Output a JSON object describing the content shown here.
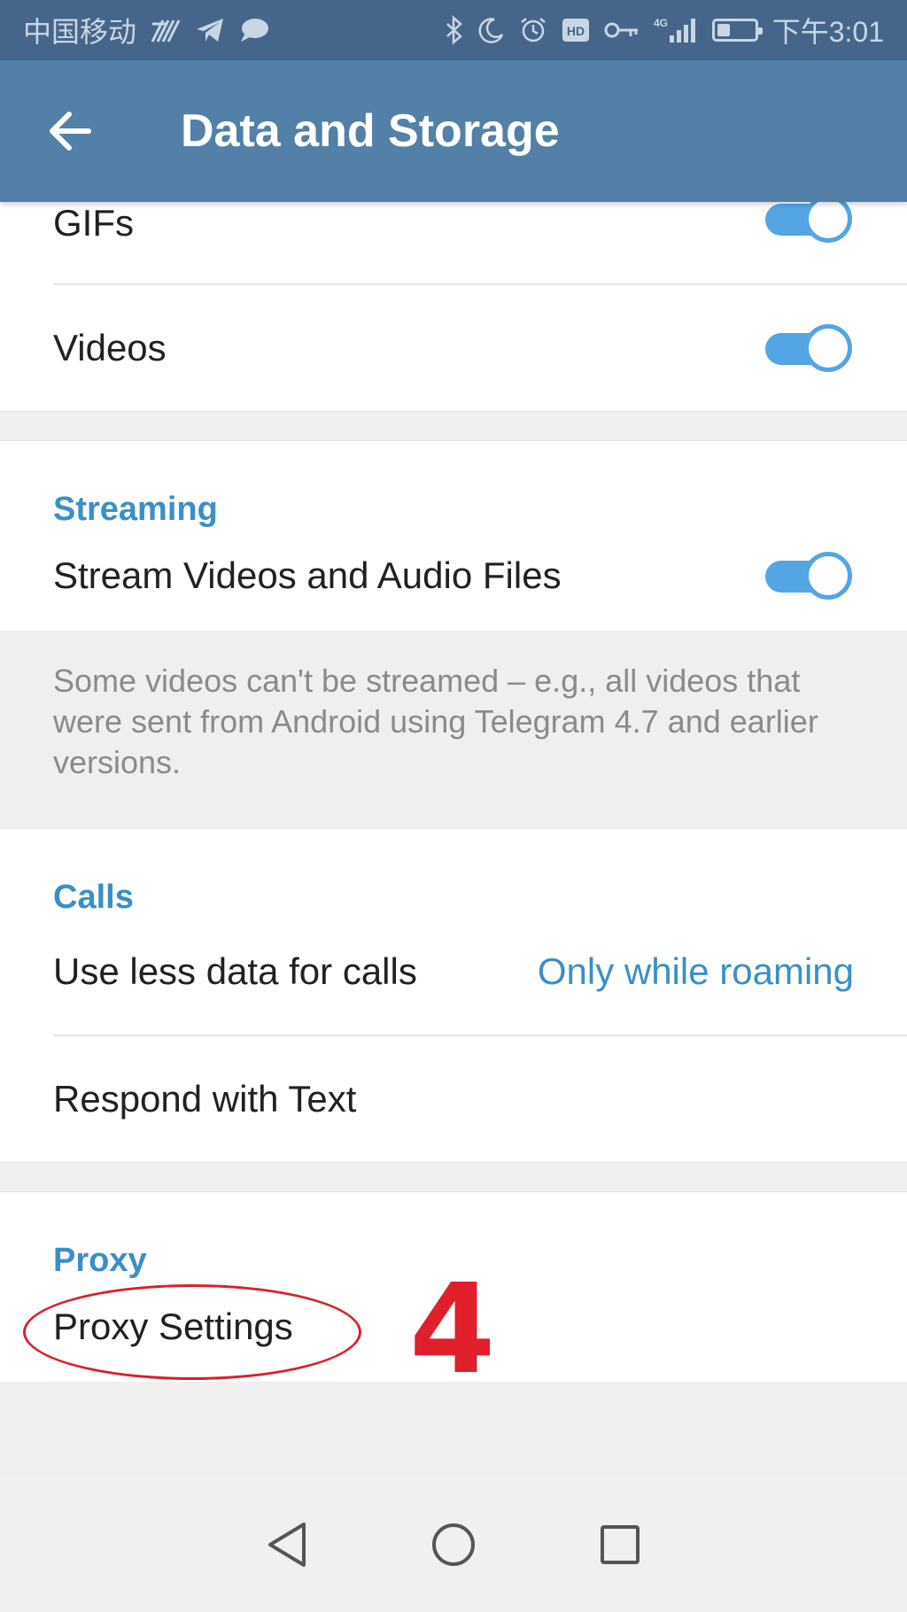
{
  "status_bar": {
    "carrier": "中国移动",
    "network": "4G",
    "time": "下午3:01",
    "battery_level": 0.35,
    "left_icons": [
      "signal-wave-icon",
      "telegram-icon",
      "chat-bubble-icon"
    ],
    "right_icons": [
      "bluetooth-icon",
      "moon-icon",
      "alarm-icon",
      "hd-icon",
      "vpn-key-icon",
      "cellular-signal-icon",
      "battery-icon"
    ]
  },
  "app_bar": {
    "title": "Data and Storage",
    "back_icon": "arrow-left-icon"
  },
  "media_autoplay": {
    "items": [
      {
        "label": "GIFs",
        "enabled": true
      },
      {
        "label": "Videos",
        "enabled": true
      }
    ]
  },
  "streaming": {
    "header": "Streaming",
    "item_label": "Stream Videos and Audio Files",
    "enabled": true,
    "info": "Some videos can't be streamed – e.g., all videos that were sent from Android using Telegram 4.7 and earlier versions."
  },
  "calls": {
    "header": "Calls",
    "less_data_label": "Use less data for calls",
    "less_data_value": "Only while roaming",
    "respond_label": "Respond with Text"
  },
  "proxy": {
    "header": "Proxy",
    "settings_label": "Proxy Settings",
    "annotation_number": "4"
  },
  "colors": {
    "status_bar": "#45668a",
    "app_bar": "#5280a6",
    "accent": "#3a8fc8",
    "toggle": "#54a5e3",
    "annotation": "#e01f2a"
  },
  "nav_bar": {
    "buttons": [
      "back-triangle-icon",
      "home-circle-icon",
      "recents-square-icon"
    ]
  }
}
